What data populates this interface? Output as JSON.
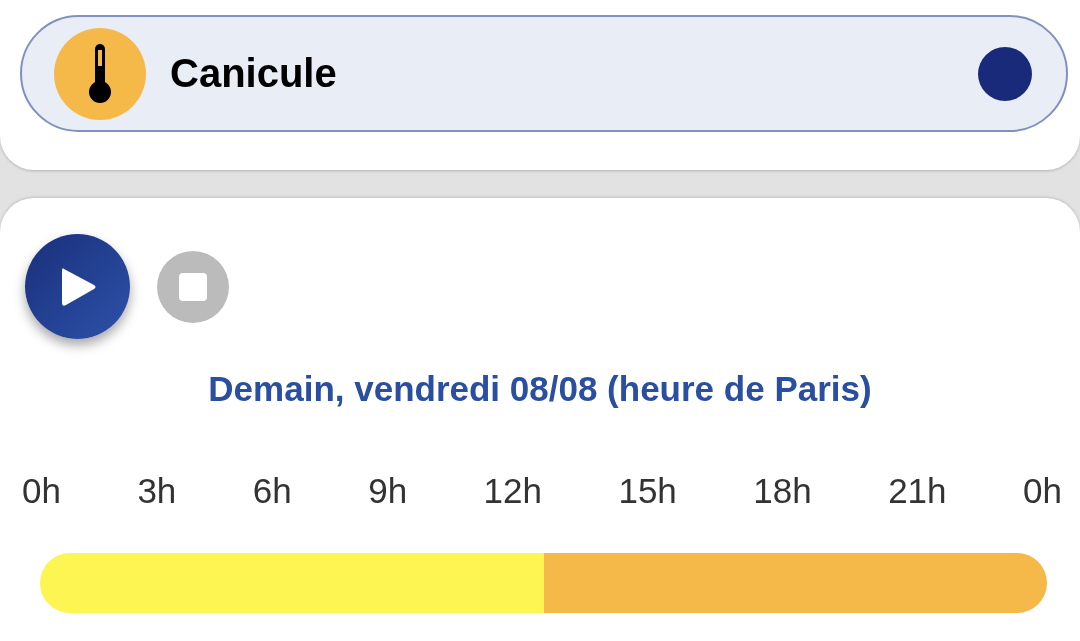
{
  "alert": {
    "label": "Canicule",
    "color": "#1a2a7a"
  },
  "player": {
    "date_title": "Demain, vendredi 08/08 (heure de Paris)"
  },
  "hours": [
    "0h",
    "3h",
    "6h",
    "9h",
    "12h",
    "15h",
    "18h",
    "21h",
    "0h"
  ],
  "slots": [
    {
      "color": "#fdf552"
    },
    {
      "color": "#fdf552"
    },
    {
      "color": "#fdf552"
    },
    {
      "color": "#fdf552"
    },
    {
      "color": "#f5b94a"
    },
    {
      "color": "#f5b94a"
    },
    {
      "color": "#f5b94a"
    },
    {
      "color": "#f5b94a"
    }
  ]
}
